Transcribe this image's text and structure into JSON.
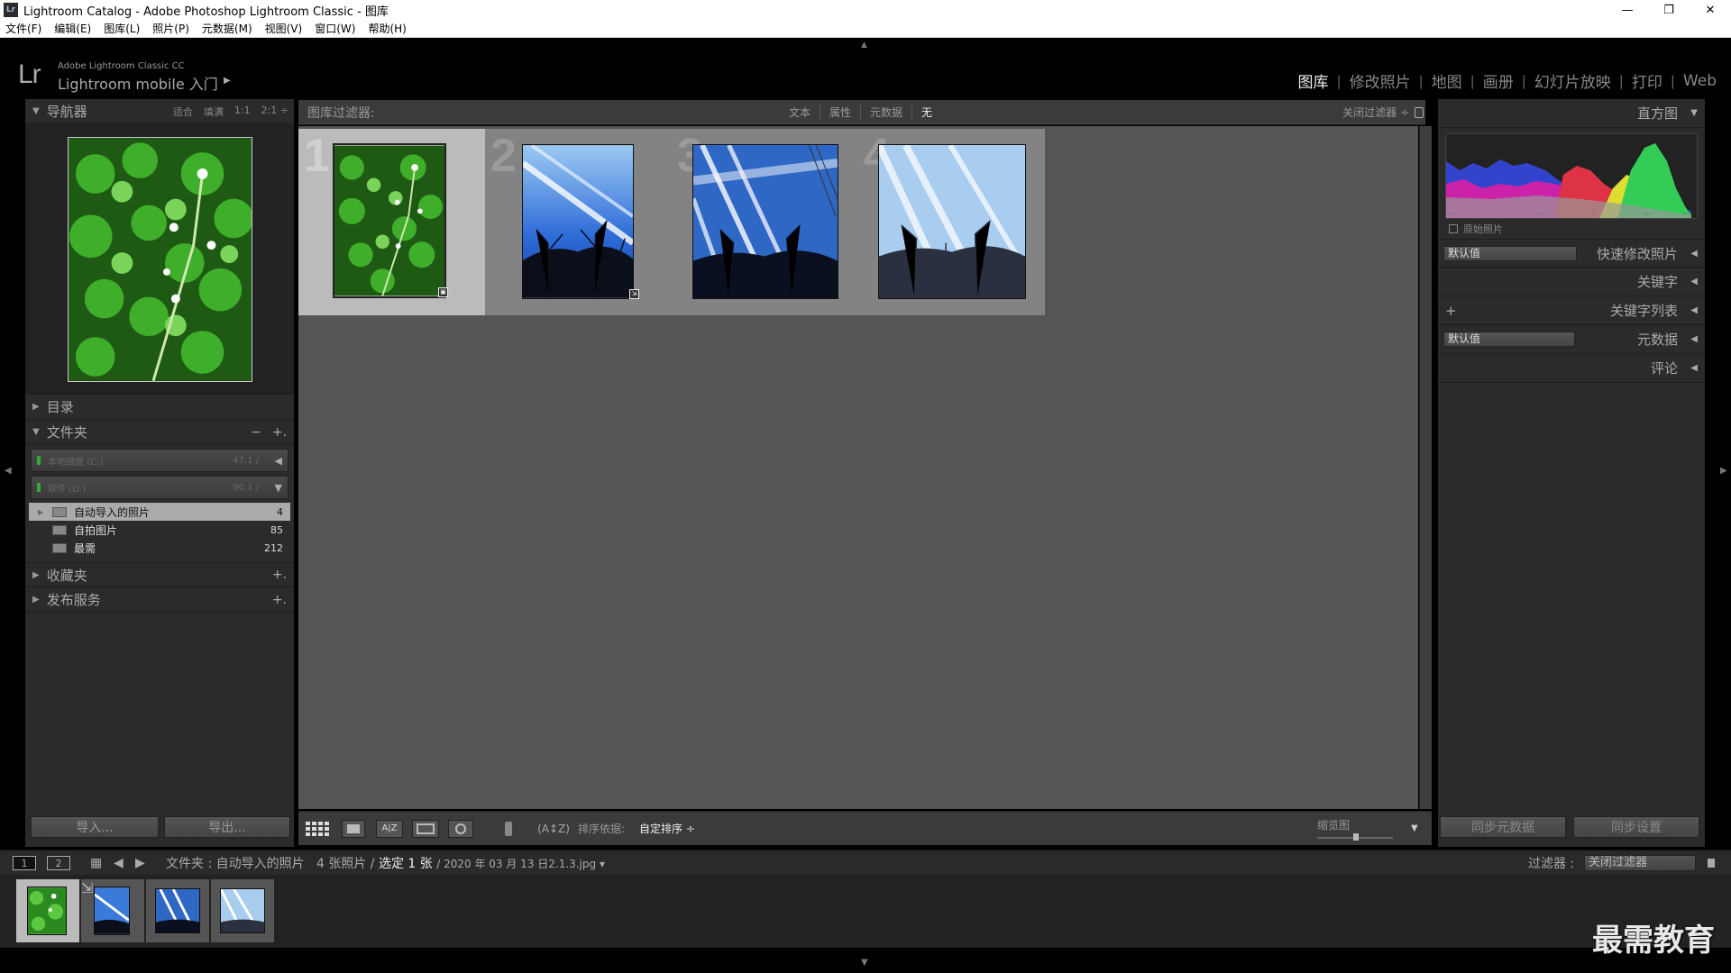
{
  "window": {
    "title": "Lightroom Catalog - Adobe Photoshop Lightroom Classic - 图库",
    "controls": [
      "—",
      "❐",
      "✕"
    ]
  },
  "menu": [
    "文件(F)",
    "编辑(E)",
    "图库(L)",
    "照片(P)",
    "元数据(M)",
    "视图(V)",
    "窗口(W)",
    "帮助(H)"
  ],
  "identity": {
    "logo": "Lr",
    "small": "Adobe Lightroom Classic CC",
    "big": "Lightroom mobile 入门",
    "arrow": "▶"
  },
  "modules": [
    "图库",
    "修改照片",
    "地图",
    "画册",
    "幻灯片放映",
    "打印",
    "Web"
  ],
  "navigator": {
    "title": "导航器",
    "opts": [
      "适合",
      "填满",
      "1:1",
      "2:1 ÷"
    ]
  },
  "catalog": {
    "title": "目录"
  },
  "folders": {
    "title": "文件夹",
    "minus": "−",
    "plus": "+.",
    "volumes": [
      {
        "name": "本地磁盘 (C:)",
        "cap": "47.1 /",
        "arrow": "◀"
      },
      {
        "name": "软件 (D:)",
        "cap": "90.1 /",
        "arrow": "▼"
      }
    ],
    "items": [
      {
        "name": "自动导入的照片",
        "count": "4"
      },
      {
        "name": "自拍图片",
        "count": "85"
      },
      {
        "name": "最需",
        "count": "212"
      }
    ]
  },
  "collections": {
    "title": "收藏夹",
    "plus": "+."
  },
  "publish": {
    "title": "发布服务",
    "plus": "+."
  },
  "left_buttons": {
    "import": "导入...",
    "export": "导出..."
  },
  "filterbar": {
    "label": "图库过滤器:",
    "opts": [
      "文本",
      "属性",
      "元数据",
      "无"
    ],
    "close": "关闭过滤器 ÷"
  },
  "grid": {
    "numbers": [
      "1",
      "2",
      "3",
      "4"
    ]
  },
  "toolbar": {
    "sort_label": "排序依据:",
    "sort_value": "自定排序 ÷",
    "thumb_label": "缩览图",
    "az": "A|Z"
  },
  "right": {
    "histogram": "直方图",
    "original_photo": "原始照片",
    "preset_default": "默认值",
    "quick_develop": "快速修改照片",
    "keywording": "关键字",
    "keyword_list": "关键字列表",
    "metadata_default": "默认值",
    "metadata": "元数据",
    "comments": "评论",
    "plus": "+"
  },
  "right_buttons": {
    "sync_meta": "同步元数据",
    "sync_settings": "同步设置"
  },
  "filmstrip_bar": {
    "page1": "1",
    "page2": "2",
    "path": "文件夹 : 自动导入的照片",
    "count": "4 张照片 /",
    "selected": "选定 1 张",
    "file": "/ 2020 年 03 月 13 日2.1.3.jpg ▾",
    "filter_label": "过滤器 :",
    "filter_value": "关闭过滤器"
  },
  "watermark": "最需教育",
  "colors": {
    "bg": "#2b2b2b",
    "grid": "#555555",
    "selected_cell": "#bbbbbb",
    "cell": "#838383"
  }
}
